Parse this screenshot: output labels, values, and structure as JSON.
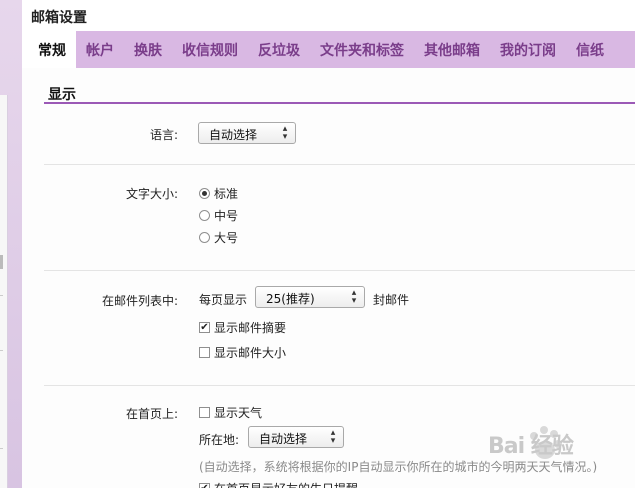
{
  "page": {
    "title": "邮箱设置"
  },
  "tabs": [
    {
      "label": "常规",
      "active": true
    },
    {
      "label": "帐户",
      "active": false
    },
    {
      "label": "换肤",
      "active": false
    },
    {
      "label": "收信规则",
      "active": false
    },
    {
      "label": "反垃圾",
      "active": false
    },
    {
      "label": "文件夹和标签",
      "active": false
    },
    {
      "label": "其他邮箱",
      "active": false
    },
    {
      "label": "我的订阅",
      "active": false
    },
    {
      "label": "信纸",
      "active": false
    }
  ],
  "section": {
    "title": "显示"
  },
  "language": {
    "label": "语言:",
    "selected": "自动选择"
  },
  "font_size": {
    "label": "文字大小:",
    "options": [
      "标准",
      "中号",
      "大号"
    ],
    "selected_index": 0
  },
  "mail_list": {
    "label": "在邮件列表中:",
    "per_page_prefix": "每页显示",
    "per_page_value": "25(推荐)",
    "per_page_suffix": "封邮件",
    "show_summary": {
      "label": "显示邮件摘要",
      "checked": true
    },
    "show_size": {
      "label": "显示邮件大小",
      "checked": false
    }
  },
  "home_page": {
    "label": "在首页上:",
    "show_weather": {
      "label": "显示天气",
      "checked": false
    },
    "location_label": "所在地:",
    "location_value": "自动选择",
    "hint": "(自动选择，系统将根据你的IP自动显示你所在的城市的今明两天天气情况。)",
    "next_item": "在首页显示好友的生日提醒"
  },
  "watermark": {
    "text": "Bai 经验"
  },
  "colors": {
    "tab_bar": "#d9b8e3",
    "tab_text": "#7a3d8a",
    "section_rule": "#9b59b6"
  }
}
